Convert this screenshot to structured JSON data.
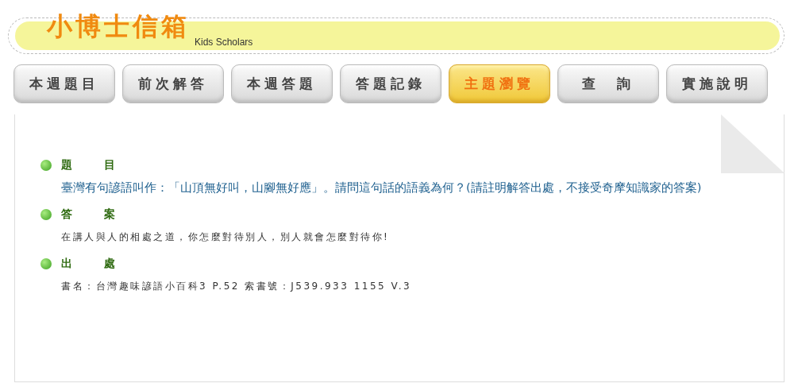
{
  "header": {
    "logo": "小博士信箱",
    "subtitle": "Kids Scholars"
  },
  "tabs": [
    {
      "label": "本週題目",
      "selected": false
    },
    {
      "label": "前次解答",
      "selected": false
    },
    {
      "label": "本週答題",
      "selected": false
    },
    {
      "label": "答題記錄",
      "selected": false
    },
    {
      "label": "主題瀏覽",
      "selected": true
    },
    {
      "label": "查　詢",
      "selected": false
    },
    {
      "label": "實施說明",
      "selected": false
    }
  ],
  "sections": [
    {
      "heading": "題目",
      "kind": "question",
      "text": "臺灣有句諺語叫作：「山頂無好叫，山腳無好應」。請問這句話的語義為何？(請註明解答出處，不接受奇摩知識家的答案)"
    },
    {
      "heading": "答案",
      "kind": "note",
      "text": "在講人與人的相處之道，你怎麼對待別人，別人就會怎麼對待你!"
    },
    {
      "heading": "出處",
      "kind": "note",
      "text": "書名：台灣趣味諺語小百科3 P.52 索書號：J539.933 1155 V.3"
    }
  ]
}
